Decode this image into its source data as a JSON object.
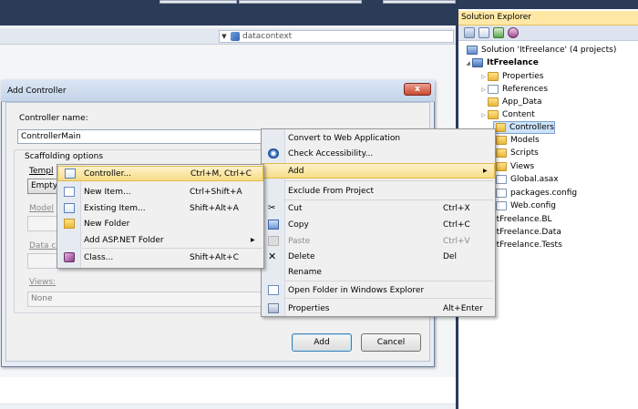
{
  "editor": {
    "nav_combo_text": "datacontext"
  },
  "solution_explorer": {
    "title": "Solution Explorer",
    "solution_label": "Solution 'ItFreelance' (4 projects)",
    "items": [
      {
        "label": "ItFreelance",
        "icon": "project-icon"
      },
      {
        "label": "Properties",
        "icon": "folder-icon"
      },
      {
        "label": "References",
        "icon": "references-icon"
      },
      {
        "label": "App_Data",
        "icon": "folder-icon"
      },
      {
        "label": "Content",
        "icon": "folder-icon"
      },
      {
        "label": "Controllers",
        "icon": "folder-icon"
      },
      {
        "label": "Models",
        "icon": "folder-icon"
      },
      {
        "label": "Scripts",
        "icon": "folder-icon"
      },
      {
        "label": "Views",
        "icon": "folder-icon"
      },
      {
        "label": "Global.asax",
        "icon": "file-icon"
      },
      {
        "label": "packages.config",
        "icon": "file-icon"
      },
      {
        "label": "Web.config",
        "icon": "file-icon"
      },
      {
        "label": "ItFreelance.BL",
        "icon": "project-icon"
      },
      {
        "label": "ItFreelance.Data",
        "icon": "project-icon"
      },
      {
        "label": "ItFreelance.Tests",
        "icon": "project-icon"
      }
    ]
  },
  "dialog": {
    "title": "Add Controller",
    "close_label": "x",
    "controller_name_label": "Controller name:",
    "controller_name_value": "ControllerMain",
    "scaffolding_label": "Scaffolding options",
    "template_label": "Templ",
    "template_value": "Empty",
    "model_label": "Model",
    "data_context_label": "Data co",
    "views_label": "Views:",
    "views_value": "None",
    "add_button": "Add",
    "cancel_button": "Cancel"
  },
  "context_menu": {
    "items": [
      {
        "label": "Convert to Web Application",
        "shortcut": ""
      },
      {
        "label": "Check Accessibility...",
        "shortcut": ""
      },
      {
        "label": "Add",
        "shortcut": ""
      },
      {
        "label": "Exclude From Project",
        "shortcut": ""
      },
      {
        "label": "Cut",
        "shortcut": "Ctrl+X"
      },
      {
        "label": "Copy",
        "shortcut": "Ctrl+C"
      },
      {
        "label": "Paste",
        "shortcut": "Ctrl+V"
      },
      {
        "label": "Delete",
        "shortcut": "Del"
      },
      {
        "label": "Rename",
        "shortcut": ""
      },
      {
        "label": "Open Folder in Windows Explorer",
        "shortcut": ""
      },
      {
        "label": "Properties",
        "shortcut": "Alt+Enter"
      }
    ]
  },
  "add_submenu": {
    "items": [
      {
        "label": "Controller...",
        "shortcut": "Ctrl+M, Ctrl+C"
      },
      {
        "label": "New Item...",
        "shortcut": "Ctrl+Shift+A"
      },
      {
        "label": "Existing Item...",
        "shortcut": "Shift+Alt+A"
      },
      {
        "label": "New Folder",
        "shortcut": ""
      },
      {
        "label": "Add ASP.NET Folder",
        "shortcut": ""
      },
      {
        "label": "Class...",
        "shortcut": "Shift+Alt+C"
      }
    ]
  },
  "colors": {
    "title_bar": "#2b3c59",
    "selection": "#f7dd86",
    "tree_highlight": "#cde3fb"
  }
}
